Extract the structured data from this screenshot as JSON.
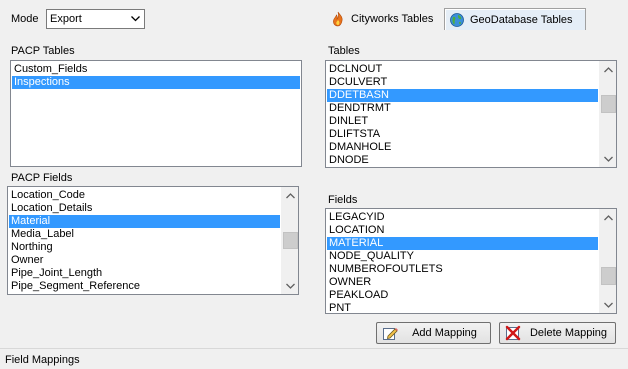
{
  "mode": {
    "label": "Mode",
    "value": "Export"
  },
  "tabs": [
    {
      "label": "Cityworks Tables",
      "icon": "cityworks-flame-icon",
      "active": false
    },
    {
      "label": "GeoDatabase Tables",
      "icon": "globe-icon",
      "active": true
    }
  ],
  "pacp_tables": {
    "label": "PACP Tables",
    "items": [
      "Custom_Fields",
      "Inspections"
    ],
    "selected": "Inspections"
  },
  "pacp_fields": {
    "label": "PACP Fields",
    "items": [
      "Location_Code",
      "Location_Details",
      "Material",
      "Media_Label",
      "Northing",
      "Owner",
      "Pipe_Joint_Length",
      "Pipe_Segment_Reference"
    ],
    "selected": "Material"
  },
  "tables": {
    "label": "Tables",
    "items": [
      "DCLNOUT",
      "DCULVERT",
      "DDETBASN",
      "DENDTRMT",
      "DINLET",
      "DLIFTSTA",
      "DMANHOLE",
      "DNODE"
    ],
    "selected": "DDETBASN"
  },
  "fields": {
    "label": "Fields",
    "items": [
      "LEGACYID",
      "LOCATION",
      "MATERIAL",
      "NODE_QUALITY",
      "NUMBEROFOUTLETS",
      "OWNER",
      "PEAKLOAD",
      "PNT"
    ],
    "selected": "MATERIAL"
  },
  "buttons": {
    "add_mapping": "Add Mapping",
    "delete_mapping": "Delete Mapping"
  },
  "status": {
    "field_mappings_label": "Field Mappings"
  },
  "colors": {
    "selection": "#3399ff",
    "window_bg": "#f0f0f0",
    "active_tab_bg": "#e5eef7"
  }
}
